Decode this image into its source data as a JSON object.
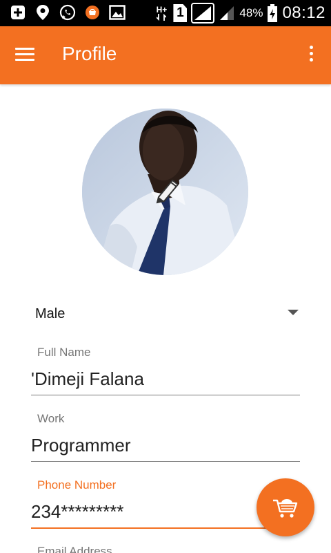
{
  "status_bar": {
    "battery": "48%",
    "time": "08:12",
    "sim_slot": "1",
    "network_type": "H+",
    "icons": [
      "add-box-icon",
      "location-icon",
      "whatsapp-icon",
      "app-notification-icon",
      "image-icon",
      "signal-icon",
      "battery-charging-icon"
    ]
  },
  "app_bar": {
    "title": "Profile",
    "color": "#f37021"
  },
  "gender": {
    "value": "Male"
  },
  "fields": {
    "full_name": {
      "label": "Full Name",
      "value": "'Dimeji Falana"
    },
    "work": {
      "label": "Work",
      "value": "Programmer"
    },
    "phone": {
      "label": "Phone Number",
      "value": "234*********"
    },
    "email": {
      "label": "Email Address"
    }
  },
  "fab": {
    "icon": "cart-icon"
  }
}
